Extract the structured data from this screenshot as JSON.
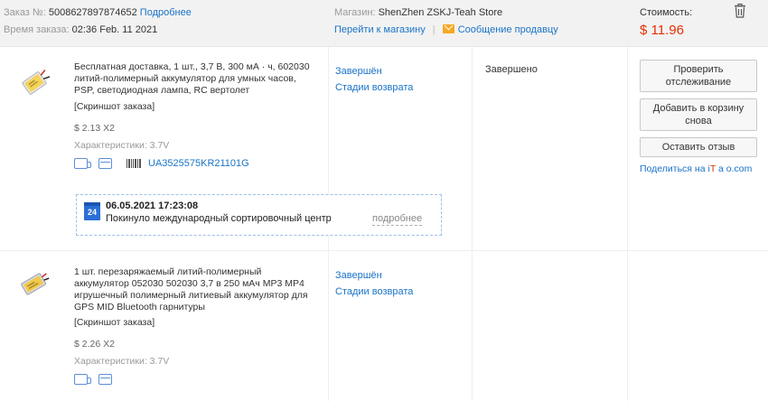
{
  "header": {
    "order_label": "Заказ №:",
    "order_number": "5008627897874652",
    "details_link": "Подробнее",
    "time_label": "Время заказа:",
    "time_value": "02:36 Feb. 11 2021",
    "store_label": "Магазин:",
    "store_name": "ShenZhen ZSKJ-Teah Store",
    "go_to_store": "Перейти к магазину",
    "message_seller": "Сообщение продавцу",
    "cost_label": "Стоимость:",
    "cost_value": "$ 11.96"
  },
  "items": [
    {
      "description": "Бесплатная доставка, 1 шт., 3,7 В, 300 мА · ч, 602030 литий-полимерный аккумулятор для умных часов, PSP, светодиодная лампа, RC вертолет",
      "snapshot": "[Скриншот заказа]",
      "price": "$ 2.13 X2",
      "specs": "Характеристики: 3.7V",
      "tracking_number": "UA3525575KR21101G",
      "status": "Завершён",
      "return_stages": "Стадии возврата",
      "state": "Завершено",
      "tracking": {
        "calendar_day": "24",
        "date": "06.05.2021 17:23:08",
        "event": "Покинуло международный сортировочный центр",
        "more": "подробнее"
      }
    },
    {
      "description": "1 шт. перезаряжаемый литий-полимерный аккумулятор 052030 502030 3,7 в 250 мАч MP3 MP4 игрушечный полимерный литиевый аккумулятор для GPS MID Bluetooth гарнитуры",
      "snapshot": "[Скриншот заказа]",
      "price": "$ 2.26 X2",
      "specs": "Характеристики: 3.7V",
      "status": "Завершён",
      "return_stages": "Стадии возврата"
    }
  ],
  "actions": {
    "track": "Проверить отслеживание",
    "add_to_cart": "Добавить в корзину снова",
    "review": "Оставить отзыв",
    "share_prefix": "Поделиться на ",
    "share_i": "i",
    "share_t": "T",
    "share_rest": " a o.com"
  },
  "colors": {
    "accent_blue": "#1a73c8",
    "price_red": "#e62e04",
    "header_bg": "#f2f2f2"
  }
}
